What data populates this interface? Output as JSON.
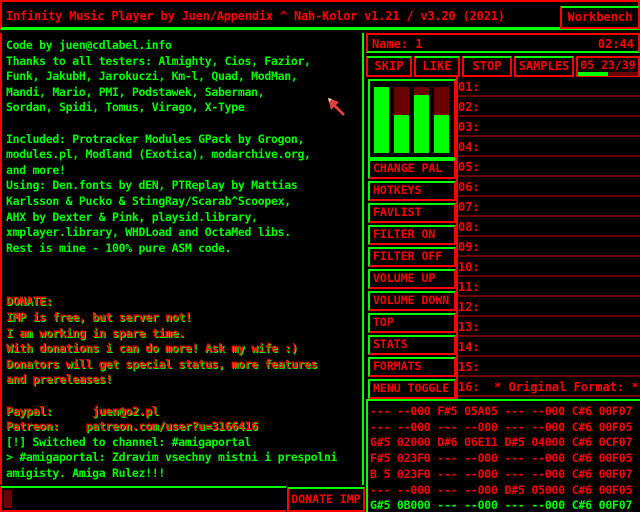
{
  "titlebar": {
    "title": "Infinity Music Player by Juen/Appendix ^ Nah-Kolor v1.21 / v3.20 (2021)",
    "workbench_label": "Workbench"
  },
  "info_text": {
    "lines_green_1": [
      "Code by juen@cdlabel.info",
      "Thanks to all testers: Almighty, Cios, Fazior,",
      "Funk, JakubH, Jarokuczi, Km-l, Quad, ModMan,",
      "Mandi, Mario, PMI, Podstawek, Saberman,",
      "Sordan, Spidi, Tomus, Virago, X-Type",
      "",
      "Included: Protracker Modules GPack by Grogon,",
      "modules.pl, Modland (Exotica), modarchive.org,",
      "and more!",
      "Using: Den.fonts by dEN, PTReplay by Mattias",
      "Karlsson & Pucko & StingRay/Scarab^Scoopex,",
      "AHX by Dexter & Pink, playsid.library,",
      "xmplayer.library, WHDLoad and OctaMed libs.",
      "Rest is mine - 100% pure ASM code."
    ],
    "lines_donate": [
      "DONATE:",
      "IMP is free, but server not!",
      "I am working in spare time.",
      "With donations i can do more! Ask my wife :)",
      "Donators will get special status, more features",
      "and prereleases!",
      "",
      "Paypal:      juen@o2.pl",
      "Patreon:    patreon.com/user?u=3166416"
    ],
    "lines_green_2": [
      "[!] Switched to channel: #amigaportal",
      "> #amigaportal: Zdravim vsechny mistni i prespolni",
      "amigisty. Amiga Rulez!!!"
    ]
  },
  "chat_input": {
    "value": ""
  },
  "donate_button": "DONATE IMP",
  "player": {
    "name_label": "Name: 1",
    "time": "02:44",
    "transport": [
      "SKIP",
      "LIKE",
      "STOP",
      "SAMPLES"
    ],
    "position": "05 23/39",
    "position_progress": 0.5,
    "vu_levels": [
      1.0,
      0.58,
      0.88,
      0.58
    ],
    "menu": [
      "CHANGE PAL",
      "HOTKEYS",
      "FAVLIST",
      "FILTER ON",
      "FILTER OFF",
      "VOLUME UP",
      "VOLUME DOWN",
      "TOP",
      "STATS",
      "FORMATS",
      "MENU TOGGLE"
    ],
    "channels": [
      "01:",
      "02:",
      "03:",
      "04:",
      "05:",
      "06:",
      "07:",
      "08:",
      "09:",
      "10:",
      "11:",
      "12:",
      "13:",
      "14:",
      "15:",
      "16:  * Original Format: *"
    ]
  },
  "pattern": {
    "rows": [
      "--- --000 F#5 05A05 --- --000 C#6 00F07",
      "--- --000 --- --000 --- --000 C#6 00F05",
      "G#5 02000 D#6 06E11 D#5 04000 C#6 0CF07",
      "F#5 023F0 --- --000 --- --000 C#6 00F05",
      "B 5 023F0 --- --000 --- --000 C#6 00F07",
      "--- --000 --- --000 D#5 05000 C#6 00F05",
      "G#5 0B000 --- --000 --- --000 C#6 00F07"
    ],
    "current_row_index": 6
  },
  "colors": {
    "primary": "#ff0000",
    "accent": "#00ff00",
    "dark": "#6a0000"
  }
}
